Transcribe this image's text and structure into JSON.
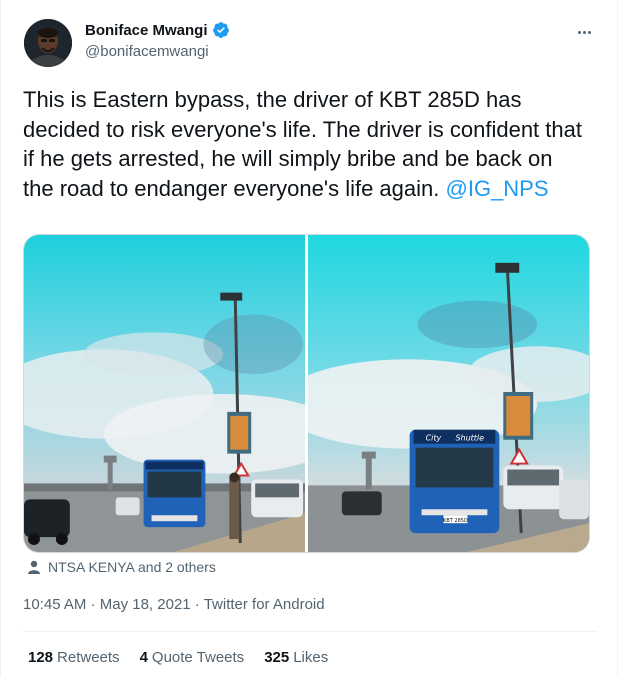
{
  "author": {
    "display_name": "Boniface Mwangi",
    "handle": "@bonifacemwangi",
    "verified": true
  },
  "tweet": {
    "text": "This is Eastern bypass, the driver of KBT 285D has decided to risk everyone's life. The driver is confident that if he gets arrested, he will simply bribe and be back on the road to endanger everyone's life again. ",
    "mention": "@IG_NPS"
  },
  "media": {
    "photo_count": 2,
    "bus_text_left": "City",
    "bus_text_right": "Shuttle",
    "bus_plate": "KBT 285D"
  },
  "social_context": {
    "icon": "person-icon",
    "text": "NTSA KENYA and 2 others"
  },
  "meta": {
    "time": "10:45 AM",
    "separator": " · ",
    "date": "May 18, 2021",
    "source": "Twitter for Android"
  },
  "stats": {
    "retweets": {
      "count": "128",
      "label": "Retweets"
    },
    "quote_tweets": {
      "count": "4",
      "label": "Quote Tweets"
    },
    "likes": {
      "count": "325",
      "label": "Likes"
    }
  },
  "colors": {
    "accent": "#1d9bf0",
    "text": "#0f1419",
    "secondary": "#536471",
    "border": "#eff3f4"
  }
}
